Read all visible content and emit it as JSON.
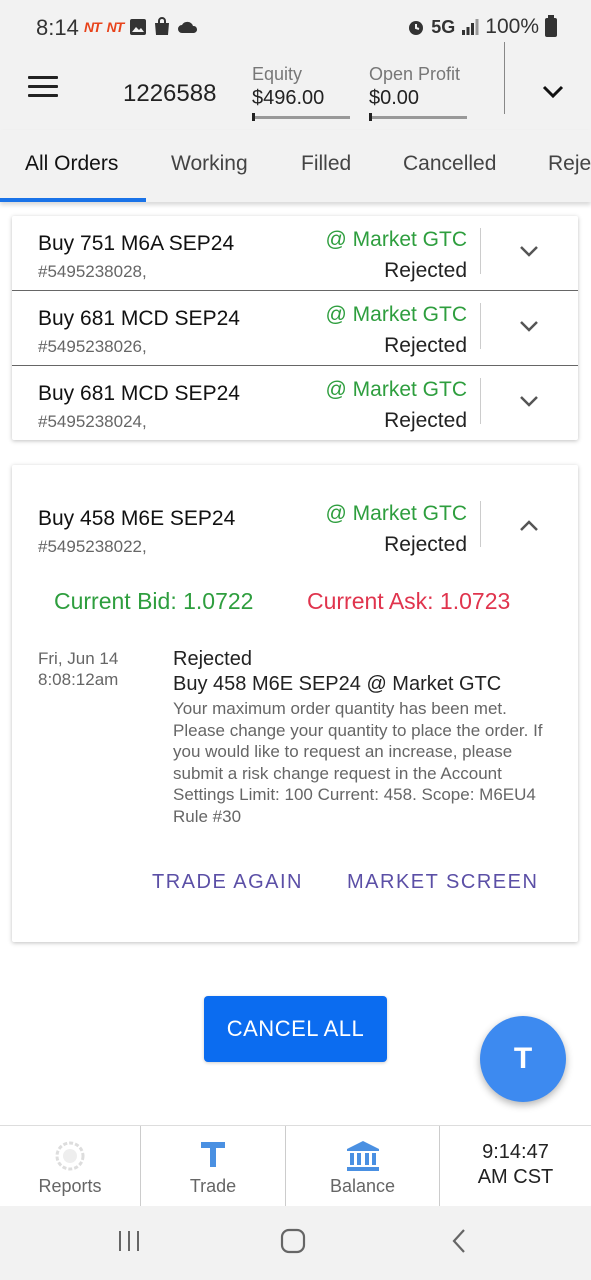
{
  "status_bar": {
    "time": "8:14",
    "network": "5G",
    "battery": "100%"
  },
  "header": {
    "account": "1226588",
    "equity_label": "Equity",
    "equity_value": "$496.00",
    "profit_label": "Open Profit",
    "profit_value": "$0.00"
  },
  "tabs": [
    "All Orders",
    "Working",
    "Filled",
    "Cancelled",
    "Reje"
  ],
  "orders": [
    {
      "title": "Buy 751 M6A SEP24",
      "id": "#5495238028,",
      "type": "@ Market GTC",
      "status": "Rejected"
    },
    {
      "title": "Buy 681 MCD SEP24",
      "id": "#5495238026,",
      "type": "@ Market GTC",
      "status": "Rejected"
    },
    {
      "title": "Buy 681 MCD SEP24",
      "id": "#5495238024,",
      "type": "@ Market GTC",
      "status": "Rejected"
    }
  ],
  "expanded_order": {
    "title": "Buy 458 M6E SEP24",
    "id": "#5495238022,",
    "type": "@ Market GTC",
    "status": "Rejected",
    "current_bid": "Current Bid: 1.0722",
    "current_ask": "Current Ask: 1.0723",
    "history": {
      "date_line1": "Fri, Jun 14",
      "date_line2": "8:08:12am",
      "status": "Rejected",
      "order": "Buy 458 M6E SEP24 @ Market GTC",
      "message": "Your maximum order quantity has been met. Please change your quantity to place the order. If you would like to request an increase, please submit a risk change request in the Account Settings Limit: 100 Current: 458. Scope: M6EU4 Rule #30"
    },
    "trade_again": "TRADE AGAIN",
    "market_screen": "MARKET SCREEN"
  },
  "cancel_all": "CANCEL ALL",
  "fab_label": "T",
  "bottom_nav": {
    "reports": "Reports",
    "trade": "Trade",
    "balance": "Balance",
    "clock_time": "9:14:47",
    "clock_zone": "AM CST"
  },
  "colors": {
    "accent": "#1a73e8",
    "positive": "#2e9e3e",
    "negative": "#e0344d",
    "text_button": "#5b4fa6",
    "cancel_button": "#0b6cf0"
  }
}
